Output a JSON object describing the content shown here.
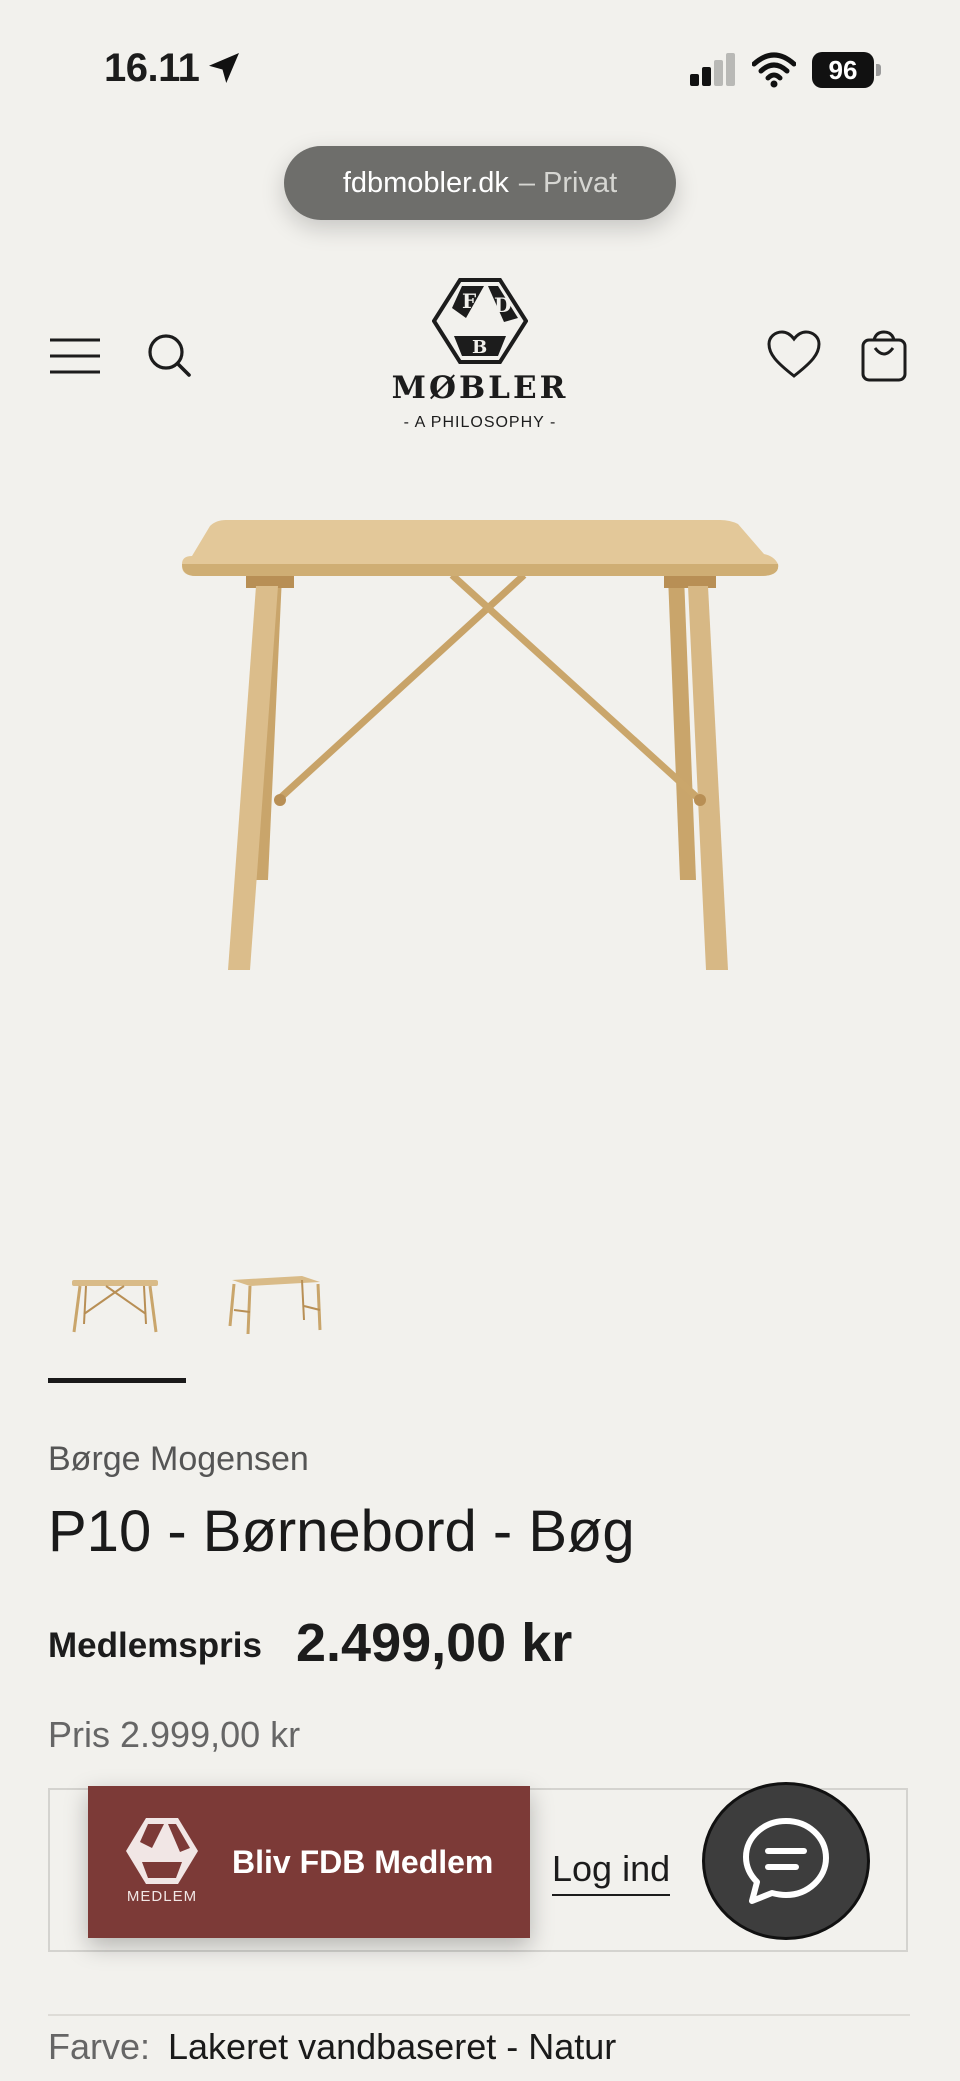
{
  "status_bar": {
    "time": "16.11",
    "battery": "96",
    "icons": [
      "location-arrow-icon",
      "cellular-signal-icon",
      "wifi-icon",
      "battery-icon"
    ]
  },
  "browser": {
    "domain": "fdbmobler.dk",
    "private_label": "– Privat"
  },
  "header": {
    "brand": "MØBLER",
    "tagline": "- A PHILOSOPHY -",
    "logo_letters": [
      "F",
      "D",
      "B"
    ],
    "icons": [
      "menu-icon",
      "search-icon",
      "heart-icon",
      "bag-icon"
    ]
  },
  "gallery": {
    "thumbnail_count": 2,
    "active_index": 0
  },
  "product": {
    "designer": "Børge Mogensen",
    "title": "P10 - Børnebord - Bøg",
    "member_price_label": "Medlemspris",
    "member_price": "2.499,00 kr",
    "regular_price": "Pris 2.999,00 kr"
  },
  "member_banner": {
    "logo_label": "MEDLEM",
    "cta": "Bliv FDB Medlem",
    "login": "Log ind"
  },
  "options": {
    "color_label": "Farve:",
    "color_value": "Lakeret vandbaseret - Natur"
  },
  "colors": {
    "background": "#f2f1ed",
    "banner": "#7c3a37",
    "pill": "#6e6e6b",
    "chat": "#3d3d3d",
    "wood": "#d8b986"
  }
}
